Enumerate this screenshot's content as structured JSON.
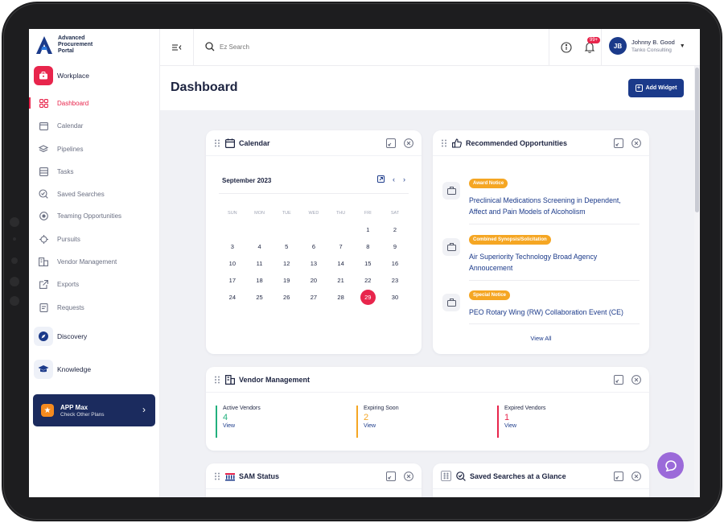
{
  "app": {
    "name_line1": "Advanced",
    "name_line2": "Procurement",
    "name_line3": "Portal"
  },
  "sidebar": {
    "workplace_label": "Workplace",
    "items": [
      {
        "label": "Dashboard",
        "icon": "grid-icon",
        "active": true
      },
      {
        "label": "Calendar",
        "icon": "calendar-icon"
      },
      {
        "label": "Pipelines",
        "icon": "layers-icon"
      },
      {
        "label": "Tasks",
        "icon": "tasks-icon"
      },
      {
        "label": "Saved Searches",
        "icon": "search-check-icon"
      },
      {
        "label": "Teaming Opportunities",
        "icon": "target-icon"
      },
      {
        "label": "Pursuits",
        "icon": "crosshair-icon"
      },
      {
        "label": "Vendor Management",
        "icon": "building-icon"
      },
      {
        "label": "Exports",
        "icon": "export-icon"
      },
      {
        "label": "Requests",
        "icon": "request-icon"
      }
    ],
    "discovery_label": "Discovery",
    "knowledge_label": "Knowledge",
    "app_max": {
      "title": "APP Max",
      "subtitle": "Check Other Plans"
    }
  },
  "topbar": {
    "search_placeholder": "Ez Search",
    "notif_count": "99+",
    "user_initials": "JB",
    "user_name": "Johnny B. Good",
    "user_org": "Tanko Consulting"
  },
  "page": {
    "title": "Dashboard",
    "add_widget_label": "Add Widget"
  },
  "calendar": {
    "title": "Calendar",
    "month": "September 2023",
    "days_of_week": [
      "SUN",
      "MON",
      "TUE",
      "WED",
      "THU",
      "FRI",
      "SAT"
    ],
    "weeks": [
      [
        "",
        "",
        "",
        "",
        "",
        "1",
        "2"
      ],
      [
        "3",
        "4",
        "5",
        "6",
        "7",
        "8",
        "9"
      ],
      [
        "10",
        "11",
        "12",
        "13",
        "14",
        "15",
        "16"
      ],
      [
        "17",
        "18",
        "19",
        "20",
        "21",
        "22",
        "23"
      ],
      [
        "24",
        "25",
        "26",
        "27",
        "28",
        "29",
        "30"
      ]
    ],
    "selected_day": "29"
  },
  "opportunities": {
    "title": "Recommended Opportunities",
    "items": [
      {
        "tag": "Award Notice",
        "title": "Preclinical Medications Screening in Dependent, Affect and Pain Models of Alcoholism"
      },
      {
        "tag": "Combined Synopsis/Solicitation",
        "title": "Air Superiority Technology Broad Agency Annoucement"
      },
      {
        "tag": "Special Notice",
        "title": "PEO Rotary Wing (RW) Collaboration Event (CE)"
      }
    ],
    "view_all": "View All"
  },
  "vendor": {
    "title": "Vendor Management",
    "stats": [
      {
        "label": "Active Vendors",
        "value": "4",
        "view": "View",
        "color": "#22b07d"
      },
      {
        "label": "Expiring Soon",
        "value": "2",
        "view": "View",
        "color": "#f5a623"
      },
      {
        "label": "Expired Vendors",
        "value": "1",
        "view": "View",
        "color": "#e8254c"
      }
    ]
  },
  "sam": {
    "title": "SAM Status"
  },
  "saved": {
    "title": "Saved Searches at a Glance"
  },
  "colors": {
    "accent": "#e8254c",
    "primary": "#1b3a8a",
    "tag": "#f5a623"
  }
}
